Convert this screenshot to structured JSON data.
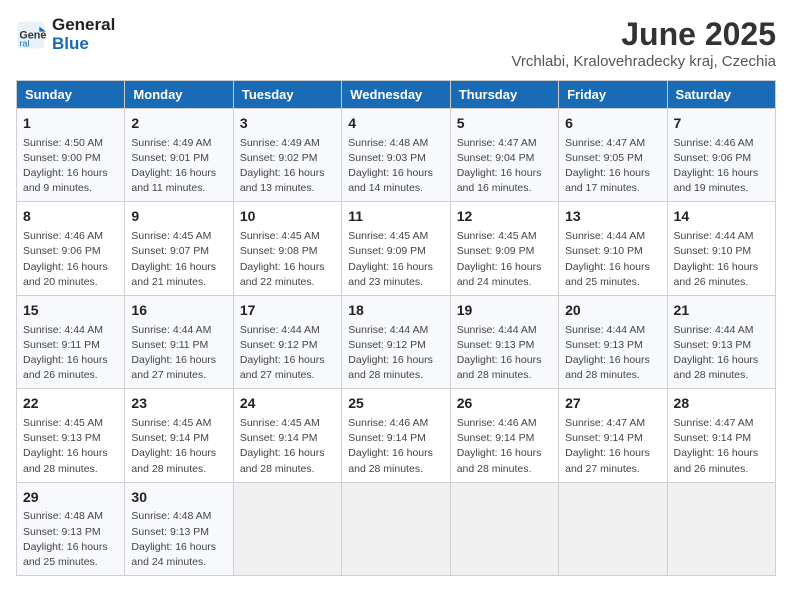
{
  "header": {
    "logo_line1": "General",
    "logo_line2": "Blue",
    "main_title": "June 2025",
    "subtitle": "Vrchlabi, Kralovehradecky kraj, Czechia"
  },
  "days_of_week": [
    "Sunday",
    "Monday",
    "Tuesday",
    "Wednesday",
    "Thursday",
    "Friday",
    "Saturday"
  ],
  "weeks": [
    [
      {
        "day": "1",
        "sunrise": "Sunrise: 4:50 AM",
        "sunset": "Sunset: 9:00 PM",
        "daylight": "Daylight: 16 hours and 9 minutes."
      },
      {
        "day": "2",
        "sunrise": "Sunrise: 4:49 AM",
        "sunset": "Sunset: 9:01 PM",
        "daylight": "Daylight: 16 hours and 11 minutes."
      },
      {
        "day": "3",
        "sunrise": "Sunrise: 4:49 AM",
        "sunset": "Sunset: 9:02 PM",
        "daylight": "Daylight: 16 hours and 13 minutes."
      },
      {
        "day": "4",
        "sunrise": "Sunrise: 4:48 AM",
        "sunset": "Sunset: 9:03 PM",
        "daylight": "Daylight: 16 hours and 14 minutes."
      },
      {
        "day": "5",
        "sunrise": "Sunrise: 4:47 AM",
        "sunset": "Sunset: 9:04 PM",
        "daylight": "Daylight: 16 hours and 16 minutes."
      },
      {
        "day": "6",
        "sunrise": "Sunrise: 4:47 AM",
        "sunset": "Sunset: 9:05 PM",
        "daylight": "Daylight: 16 hours and 17 minutes."
      },
      {
        "day": "7",
        "sunrise": "Sunrise: 4:46 AM",
        "sunset": "Sunset: 9:06 PM",
        "daylight": "Daylight: 16 hours and 19 minutes."
      }
    ],
    [
      {
        "day": "8",
        "sunrise": "Sunrise: 4:46 AM",
        "sunset": "Sunset: 9:06 PM",
        "daylight": "Daylight: 16 hours and 20 minutes."
      },
      {
        "day": "9",
        "sunrise": "Sunrise: 4:45 AM",
        "sunset": "Sunset: 9:07 PM",
        "daylight": "Daylight: 16 hours and 21 minutes."
      },
      {
        "day": "10",
        "sunrise": "Sunrise: 4:45 AM",
        "sunset": "Sunset: 9:08 PM",
        "daylight": "Daylight: 16 hours and 22 minutes."
      },
      {
        "day": "11",
        "sunrise": "Sunrise: 4:45 AM",
        "sunset": "Sunset: 9:09 PM",
        "daylight": "Daylight: 16 hours and 23 minutes."
      },
      {
        "day": "12",
        "sunrise": "Sunrise: 4:45 AM",
        "sunset": "Sunset: 9:09 PM",
        "daylight": "Daylight: 16 hours and 24 minutes."
      },
      {
        "day": "13",
        "sunrise": "Sunrise: 4:44 AM",
        "sunset": "Sunset: 9:10 PM",
        "daylight": "Daylight: 16 hours and 25 minutes."
      },
      {
        "day": "14",
        "sunrise": "Sunrise: 4:44 AM",
        "sunset": "Sunset: 9:10 PM",
        "daylight": "Daylight: 16 hours and 26 minutes."
      }
    ],
    [
      {
        "day": "15",
        "sunrise": "Sunrise: 4:44 AM",
        "sunset": "Sunset: 9:11 PM",
        "daylight": "Daylight: 16 hours and 26 minutes."
      },
      {
        "day": "16",
        "sunrise": "Sunrise: 4:44 AM",
        "sunset": "Sunset: 9:11 PM",
        "daylight": "Daylight: 16 hours and 27 minutes."
      },
      {
        "day": "17",
        "sunrise": "Sunrise: 4:44 AM",
        "sunset": "Sunset: 9:12 PM",
        "daylight": "Daylight: 16 hours and 27 minutes."
      },
      {
        "day": "18",
        "sunrise": "Sunrise: 4:44 AM",
        "sunset": "Sunset: 9:12 PM",
        "daylight": "Daylight: 16 hours and 28 minutes."
      },
      {
        "day": "19",
        "sunrise": "Sunrise: 4:44 AM",
        "sunset": "Sunset: 9:13 PM",
        "daylight": "Daylight: 16 hours and 28 minutes."
      },
      {
        "day": "20",
        "sunrise": "Sunrise: 4:44 AM",
        "sunset": "Sunset: 9:13 PM",
        "daylight": "Daylight: 16 hours and 28 minutes."
      },
      {
        "day": "21",
        "sunrise": "Sunrise: 4:44 AM",
        "sunset": "Sunset: 9:13 PM",
        "daylight": "Daylight: 16 hours and 28 minutes."
      }
    ],
    [
      {
        "day": "22",
        "sunrise": "Sunrise: 4:45 AM",
        "sunset": "Sunset: 9:13 PM",
        "daylight": "Daylight: 16 hours and 28 minutes."
      },
      {
        "day": "23",
        "sunrise": "Sunrise: 4:45 AM",
        "sunset": "Sunset: 9:14 PM",
        "daylight": "Daylight: 16 hours and 28 minutes."
      },
      {
        "day": "24",
        "sunrise": "Sunrise: 4:45 AM",
        "sunset": "Sunset: 9:14 PM",
        "daylight": "Daylight: 16 hours and 28 minutes."
      },
      {
        "day": "25",
        "sunrise": "Sunrise: 4:46 AM",
        "sunset": "Sunset: 9:14 PM",
        "daylight": "Daylight: 16 hours and 28 minutes."
      },
      {
        "day": "26",
        "sunrise": "Sunrise: 4:46 AM",
        "sunset": "Sunset: 9:14 PM",
        "daylight": "Daylight: 16 hours and 28 minutes."
      },
      {
        "day": "27",
        "sunrise": "Sunrise: 4:47 AM",
        "sunset": "Sunset: 9:14 PM",
        "daylight": "Daylight: 16 hours and 27 minutes."
      },
      {
        "day": "28",
        "sunrise": "Sunrise: 4:47 AM",
        "sunset": "Sunset: 9:14 PM",
        "daylight": "Daylight: 16 hours and 26 minutes."
      }
    ],
    [
      {
        "day": "29",
        "sunrise": "Sunrise: 4:48 AM",
        "sunset": "Sunset: 9:13 PM",
        "daylight": "Daylight: 16 hours and 25 minutes."
      },
      {
        "day": "30",
        "sunrise": "Sunrise: 4:48 AM",
        "sunset": "Sunset: 9:13 PM",
        "daylight": "Daylight: 16 hours and 24 minutes."
      },
      null,
      null,
      null,
      null,
      null
    ]
  ]
}
